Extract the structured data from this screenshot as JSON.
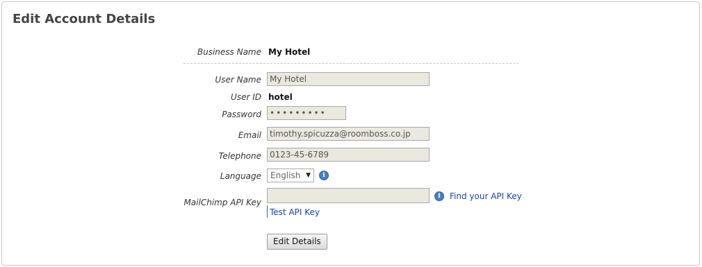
{
  "page": {
    "title": "Edit Account Details"
  },
  "form": {
    "business_name": {
      "label": "Business Name",
      "value": "My Hotel"
    },
    "user_name": {
      "label": "User Name",
      "value": "My Hotel"
    },
    "user_id": {
      "label": "User ID",
      "value": "hotel"
    },
    "password": {
      "label": "Password",
      "value": "•••••••••"
    },
    "email": {
      "label": "Email",
      "value": "timothy.spicuzza@roomboss.co.jp"
    },
    "telephone": {
      "label": "Telephone",
      "value": "0123-45-6789"
    },
    "language": {
      "label": "Language",
      "selected": "English"
    },
    "mailchimp": {
      "label": "MailChimp API Key",
      "value": "",
      "find_link": "Find your API Key",
      "test_link": "Test API Key"
    },
    "submit_label": "Edit Details"
  },
  "icons": {
    "info": "info-icon",
    "dropdown": "chevron-down-icon"
  },
  "colors": {
    "link": "#1a3eb0",
    "info": "#4a7fc1",
    "field_bg": "#ebe8e0"
  }
}
